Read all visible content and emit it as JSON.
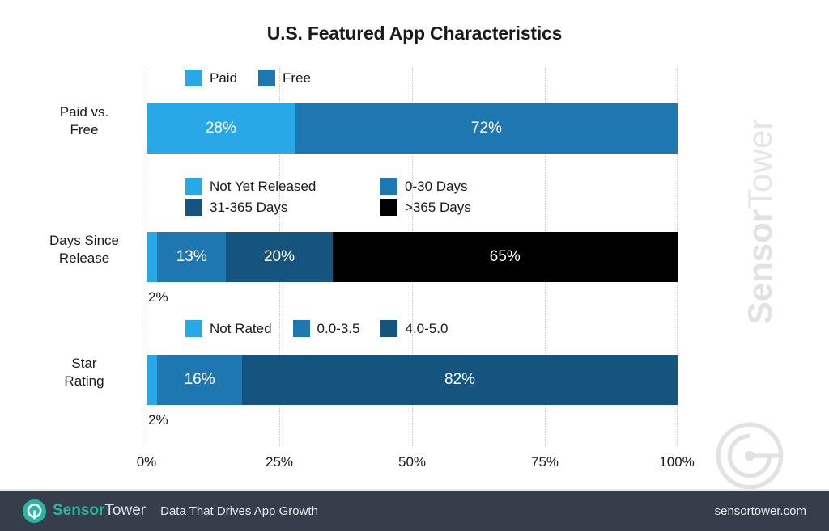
{
  "chart_data": {
    "type": "bar",
    "orientation": "horizontal",
    "stacked": true,
    "title": "U.S. Featured App Characteristics",
    "xlabel": "",
    "ylabel": "",
    "xlim": [
      0,
      100
    ],
    "xticks": [
      "0%",
      "25%",
      "50%",
      "75%",
      "100%"
    ],
    "xtick_values": [
      0,
      25,
      50,
      75,
      100
    ],
    "grid": true,
    "grid_axis": "x",
    "legend_position": "above-each-group",
    "groups": [
      {
        "category": "Paid vs. Free",
        "category_line1": "Paid vs.",
        "category_line2": "Free",
        "legend": [
          {
            "label": "Paid",
            "color": "#29a8e8"
          },
          {
            "label": "Free",
            "color": "#1e77b0"
          }
        ],
        "segments": [
          {
            "name": "Paid",
            "value": 28,
            "label": "28%",
            "color": "#29a8e8",
            "label_inside": true
          },
          {
            "name": "Free",
            "value": 72,
            "label": "72%",
            "color": "#1e77b0",
            "label_inside": true
          }
        ]
      },
      {
        "category": "Days Since Release",
        "category_line1": "Days Since",
        "category_line2": "Release",
        "legend": [
          {
            "label": "Not Yet Released",
            "color": "#29a8e8"
          },
          {
            "label": "0-30 Days",
            "color": "#1e77b0"
          },
          {
            "label": "31-365 Days",
            "color": "#14547e"
          },
          {
            "label": ">365 Days",
            "color": "#000000"
          }
        ],
        "segments": [
          {
            "name": "Not Yet Released",
            "value": 2,
            "label": "2%",
            "color": "#29a8e8",
            "label_inside": false
          },
          {
            "name": "0-30 Days",
            "value": 13,
            "label": "13%",
            "color": "#1e77b0",
            "label_inside": true
          },
          {
            "name": "31-365 Days",
            "value": 20,
            "label": "20%",
            "color": "#14547e",
            "label_inside": true
          },
          {
            "name": ">365 Days",
            "value": 65,
            "label": "65%",
            "color": "#000000",
            "label_inside": true
          }
        ]
      },
      {
        "category": "Star Rating",
        "category_line1": "Star",
        "category_line2": "Rating",
        "legend": [
          {
            "label": "Not Rated",
            "color": "#29a8e8"
          },
          {
            "label": "0.0-3.5",
            "color": "#1e77b0"
          },
          {
            "label": "4.0-5.0",
            "color": "#14547e"
          }
        ],
        "segments": [
          {
            "name": "Not Rated",
            "value": 2,
            "label": "2%",
            "color": "#29a8e8",
            "label_inside": false
          },
          {
            "name": "0.0-3.5",
            "value": 16,
            "label": "16%",
            "color": "#1e77b0",
            "label_inside": true
          },
          {
            "name": "4.0-5.0",
            "value": 82,
            "label": "82%",
            "color": "#14547e",
            "label_inside": true
          }
        ]
      }
    ]
  },
  "watermark": {
    "brand_bold": "Sensor",
    "brand_light": "Tower",
    "logo_icon": "sensortower-logo-icon"
  },
  "footer": {
    "logo_icon": "sensortower-logo-icon",
    "brand_bold": "Sensor",
    "brand_light": "Tower",
    "tagline": "Data That Drives App Growth",
    "url": "sensortower.com",
    "background_color": "#373e4b",
    "brand_color": "#2bb3a3"
  }
}
